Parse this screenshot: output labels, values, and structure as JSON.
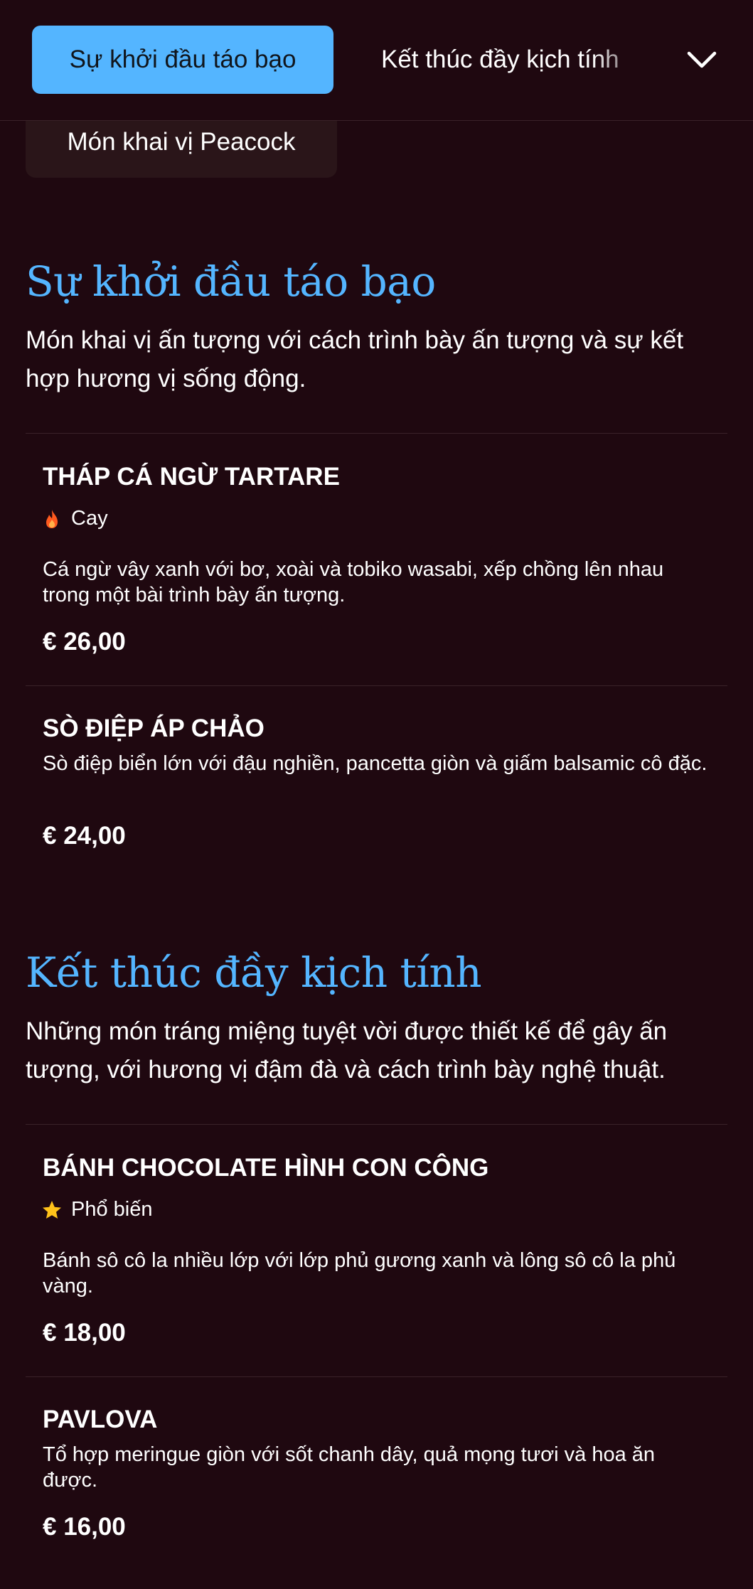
{
  "tabs": {
    "active_label": "Sự khởi đầu táo bạo",
    "next_label": "Kết thúc đầy kịch tính",
    "expand_icon": "chevron-down-icon"
  },
  "chip": {
    "label": "Món khai vị Peacock"
  },
  "sections": [
    {
      "title": "Sự khởi đầu táo bạo",
      "description": "Món khai vị ấn tượng với cách trình bày ấn tượng và sự kết hợp hương vị sống động.",
      "items": [
        {
          "name": "THÁP CÁ NGỪ TARTARE",
          "tag": {
            "label": "Cay",
            "icon": "flame-icon"
          },
          "description": "Cá ngừ vây xanh với bơ, xoài và tobiko wasabi, xếp chồng lên nhau trong một bài trình bày ấn tượng.",
          "price": "€ 26,00"
        },
        {
          "name": "SÒ ĐIỆP ÁP CHẢO",
          "description": "Sò điệp biển lớn với đậu nghiền, pancetta giòn và giấm balsamic cô đặc.",
          "price": "€ 24,00"
        }
      ]
    },
    {
      "title": "Kết thúc đầy kịch tính",
      "description": "Những món tráng miệng tuyệt vời được thiết kế để gây ấn tượng, với hương vị đậm đà và cách trình bày nghệ thuật.",
      "items": [
        {
          "name": "BÁNH CHOCOLATE HÌNH CON CÔNG",
          "tag": {
            "label": "Phổ biến",
            "icon": "star-icon"
          },
          "description": "Bánh sô cô la nhiều lớp với lớp phủ gương xanh và lông sô cô la phủ vàng.",
          "price": "€ 18,00"
        },
        {
          "name": "PAVLOVA",
          "description": "Tổ hợp meringue giòn với sốt chanh dây, quả mọng tươi và hoa ăn được.",
          "price": "€ 16,00"
        }
      ]
    }
  ],
  "colors": {
    "background": "#1f0810",
    "accent": "#54b5ff",
    "chip_bg": "#2a1519",
    "flame": "#ff5a1f",
    "star": "#ffc21a"
  }
}
